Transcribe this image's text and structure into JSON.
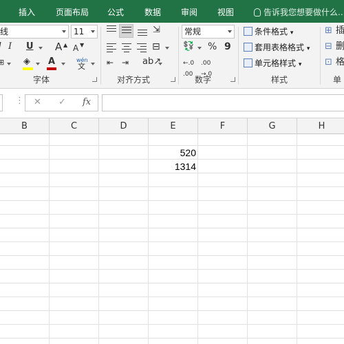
{
  "tabs": [
    {
      "label": "插入"
    },
    {
      "label": "页面布局"
    },
    {
      "label": "公式"
    },
    {
      "label": "数据"
    },
    {
      "label": "审阅"
    },
    {
      "label": "视图"
    }
  ],
  "tell_me": "告诉我您想要做什么...",
  "font": {
    "name": "线",
    "size": "11",
    "bold": "B",
    "italic": "I",
    "underline": "U",
    "grow": "A",
    "shrink": "A",
    "phonetic_top": "wén",
    "phonetic_bottom": "文",
    "font_color_letter": "A"
  },
  "number": {
    "format": "常规",
    "percent": "%",
    "comma": "9"
  },
  "styles": {
    "conditional": "条件格式",
    "table": "套用表格格式",
    "cell": "单元格样式"
  },
  "groups": {
    "font": "字体",
    "alignment": "对齐方式",
    "number": "数字",
    "styles": "样式",
    "cells_partial": "单"
  },
  "cells_partial_items": [
    "插",
    "删",
    "格"
  ],
  "formula_bar": {
    "cancel": "✕",
    "enter": "✓",
    "fx": "fx",
    "value": ""
  },
  "columns": [
    "B",
    "C",
    "D",
    "E",
    "F",
    "G",
    "H"
  ],
  "cells": {
    "e2": "520",
    "e3": "1314"
  },
  "colors": {
    "accent": "#217346",
    "font_color_bar": "#c00000",
    "fill_color_bar": "#ffff00"
  }
}
